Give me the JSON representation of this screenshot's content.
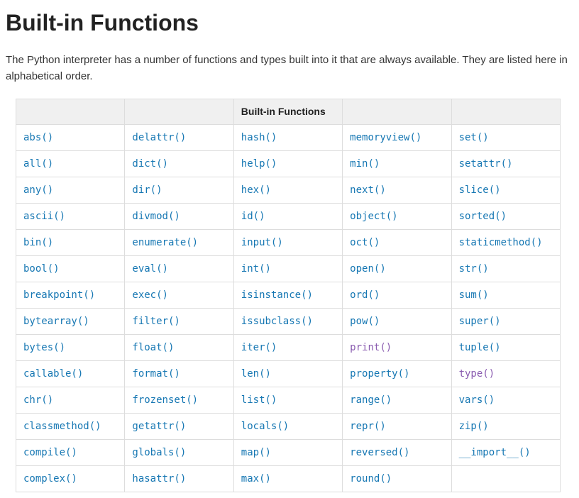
{
  "heading": "Built-in Functions",
  "intro": "The Python interpreter has a number of functions and types built into it that are always available. They are listed here in alphabetical order.",
  "tableHeader": [
    "",
    "",
    "Built-in Functions",
    "",
    ""
  ],
  "visited": [
    "print()",
    "type()"
  ],
  "columns": [
    [
      "abs()",
      "all()",
      "any()",
      "ascii()",
      "bin()",
      "bool()",
      "breakpoint()",
      "bytearray()",
      "bytes()",
      "callable()",
      "chr()",
      "classmethod()",
      "compile()",
      "complex()"
    ],
    [
      "delattr()",
      "dict()",
      "dir()",
      "divmod()",
      "enumerate()",
      "eval()",
      "exec()",
      "filter()",
      "float()",
      "format()",
      "frozenset()",
      "getattr()",
      "globals()",
      "hasattr()"
    ],
    [
      "hash()",
      "help()",
      "hex()",
      "id()",
      "input()",
      "int()",
      "isinstance()",
      "issubclass()",
      "iter()",
      "len()",
      "list()",
      "locals()",
      "map()",
      "max()"
    ],
    [
      "memoryview()",
      "min()",
      "next()",
      "object()",
      "oct()",
      "open()",
      "ord()",
      "pow()",
      "print()",
      "property()",
      "range()",
      "repr()",
      "reversed()",
      "round()"
    ],
    [
      "set()",
      "setattr()",
      "slice()",
      "sorted()",
      "staticmethod()",
      "str()",
      "sum()",
      "super()",
      "tuple()",
      "type()",
      "vars()",
      "zip()",
      "__import__()",
      ""
    ]
  ]
}
